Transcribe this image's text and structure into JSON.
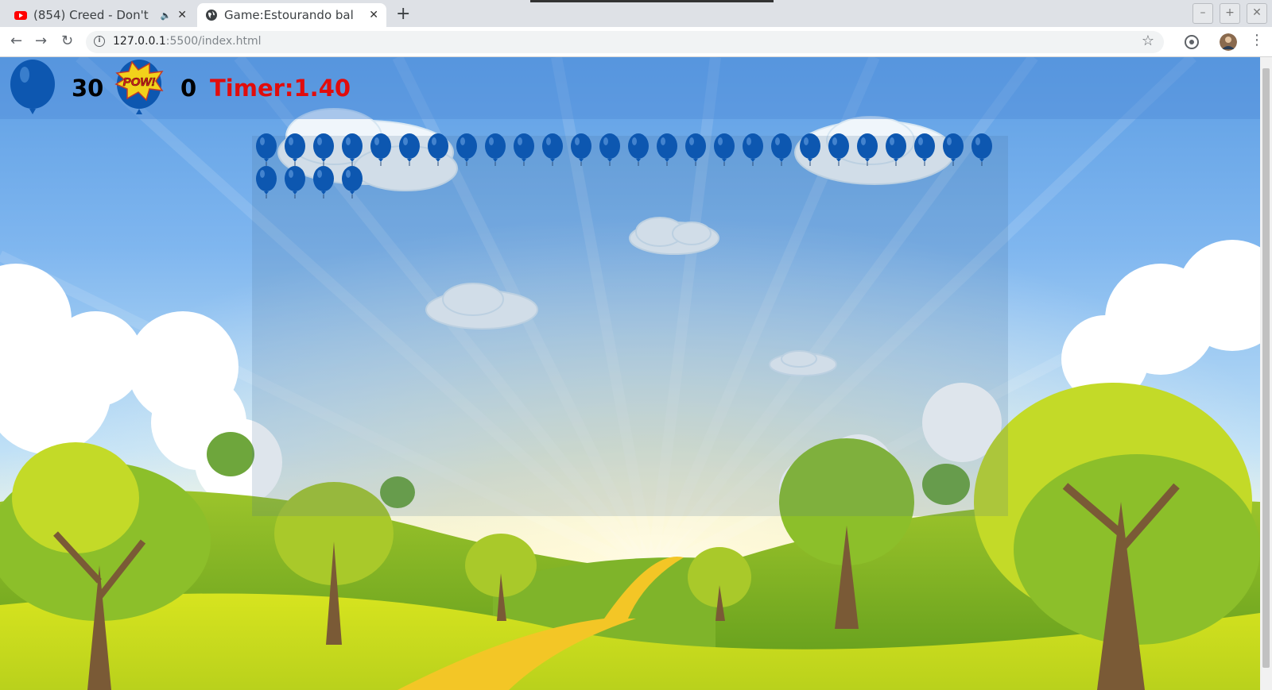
{
  "browser": {
    "tabs": [
      {
        "title": "(854) Creed - Don't",
        "favicon": "youtube-icon",
        "audio_icon": "speaker-muted-icon",
        "active": false
      },
      {
        "title": "Game:Estourando bal",
        "favicon": "globe-icon",
        "active": true
      }
    ],
    "new_tab_label": "+",
    "url_host": "127.0.0.1",
    "url_rest": ":5500/index.html",
    "window_buttons": [
      "–",
      "+",
      "✕"
    ]
  },
  "hud": {
    "balloons_remaining": "30",
    "popped": "0",
    "pow_label": "POW!",
    "timer": "Timer:1.40"
  },
  "game": {
    "balloon_color": "#0d57b0",
    "balloon_count": 30
  },
  "colors": {
    "timer": "#e10c0c",
    "sky_top": "#5d9ee4",
    "grass": "#c8df1c"
  }
}
